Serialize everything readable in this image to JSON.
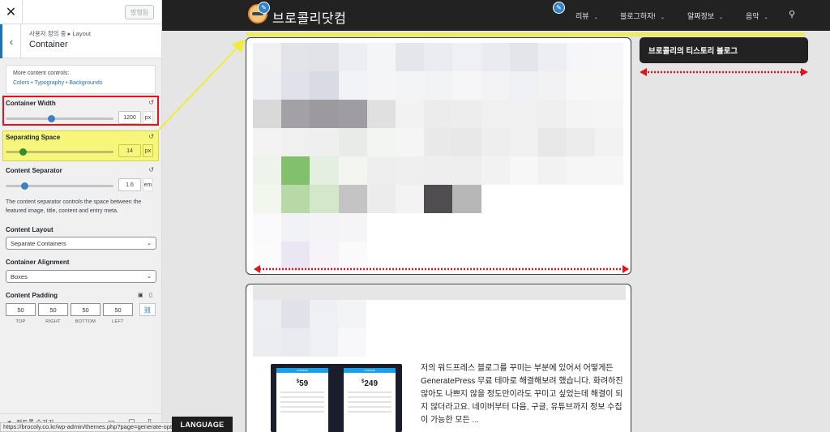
{
  "sidebar": {
    "close_icon": "close-icon",
    "publish_label": "발행됨",
    "breadcrumb": "사용자 정의 중 ▸ Layout",
    "title": "Container",
    "more_controls_label": "More content controls:",
    "more_controls_links": "Colors • Typography • Backgrounds",
    "container_width": {
      "label": "Container Width",
      "value": "1200",
      "unit": "px",
      "level": 0.42
    },
    "separating_space": {
      "label": "Separating Space",
      "value": "14",
      "unit": "px",
      "level": 0.15
    },
    "content_separator": {
      "label": "Content Separator",
      "value": "1.6",
      "unit": "em",
      "level": 0.16
    },
    "separator_description": "The content separator controls the space between the featured image, title, content and entry meta.",
    "content_layout": {
      "label": "Content Layout",
      "value": "Separate Containers"
    },
    "container_alignment": {
      "label": "Container Alignment",
      "value": "Boxes"
    },
    "content_padding": {
      "label": "Content Padding",
      "top": "50",
      "right": "50",
      "bottom": "50",
      "left": "50",
      "top_label": "TOP",
      "right_label": "RIGHT",
      "bottom_label": "BOTTOM",
      "left_label": "LEFT"
    },
    "footer_hide_label": "컨트롤 숨기기"
  },
  "status_url": "https://brocoly.co.kr/wp-admin/themes.php?page=generate-options",
  "language_button": "LANGUAGE",
  "site": {
    "title": "브로콜리닷컴",
    "nav": [
      {
        "label": "리뷰",
        "has_dropdown": true
      },
      {
        "label": "블로그하자!",
        "has_dropdown": true
      },
      {
        "label": "알짜정보",
        "has_dropdown": true
      },
      {
        "label": "음악",
        "has_dropdown": true
      }
    ],
    "search_icon": "search-icon",
    "widget_title": "브로콜리의 티스토리 블로그",
    "excerpt": "저의 워드프레스 블로그를 꾸미는 부분에 있어서 어떻게든 GeneratePress 무료 테마로 해결해보려 했습니다. 화려하진 않아도 나쁘지 않을 정도만이라도 꾸미고 싶었는데 해결이 되지 않더라고요. 네이버부터 다음, 구글, 유튜브까지 정보 수집이 가능한 모든 ...",
    "pricing": {
      "plan1_label": "STARTER",
      "plan1_price": "59",
      "plan2_label": "LIFETIME",
      "plan2_price": "249",
      "currency": "$"
    }
  },
  "colors": {
    "accent": "#2271b1",
    "slider_thumb": "#3582c4",
    "highlight_red": "#e0141e",
    "highlight_yellow": "#f6f67a",
    "arrow_red": "#e0141e"
  }
}
